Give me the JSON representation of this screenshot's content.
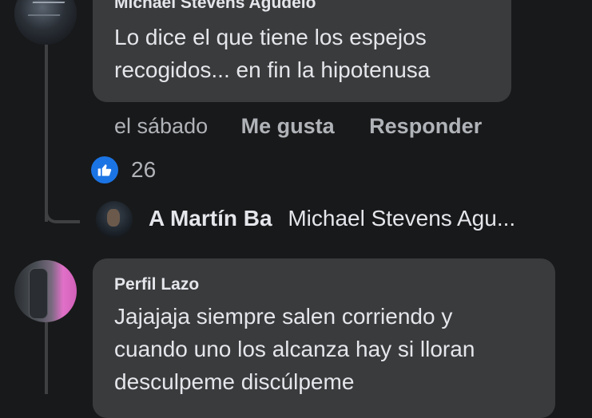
{
  "comment1": {
    "author": "Michael Stevens Agudelo",
    "lines": [
      "Lo dice el que tiene los espejos",
      "recogidos... en fin la hipotenusa"
    ],
    "time": "el sábado",
    "like_label": "Me gusta",
    "reply_label": "Responder",
    "reaction_count": "26",
    "reaction_icon": "like-icon",
    "reaction_color": "#1b74e4"
  },
  "reply_preview": {
    "author": "A Martín Ba",
    "snippet": "Michael Stevens Agu..."
  },
  "comment2": {
    "author": "Perfil Lazo",
    "lines": [
      "Jajajaja siempre salen corriendo y",
      "cuando uno los alcanza hay si lloran",
      "desculpeme discúlpeme"
    ]
  }
}
